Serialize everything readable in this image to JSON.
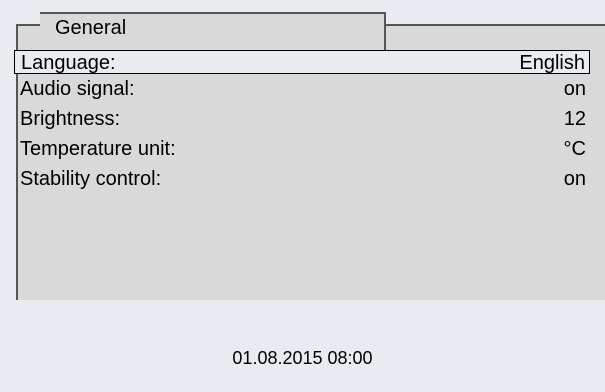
{
  "tab": {
    "label": "General"
  },
  "settings": [
    {
      "label": "Language:",
      "value": "English"
    },
    {
      "label": "Audio signal:",
      "value": "on"
    },
    {
      "label": "Brightness:",
      "value": "12"
    },
    {
      "label": "Temperature unit:",
      "value": "°C"
    },
    {
      "label": "Stability control:",
      "value": "on"
    }
  ],
  "status": {
    "datetime": "01.08.2015 08:00"
  },
  "colors": {
    "panel": "#d9d9d9",
    "background": "#e8ecf1",
    "frame_line": "#555555"
  }
}
